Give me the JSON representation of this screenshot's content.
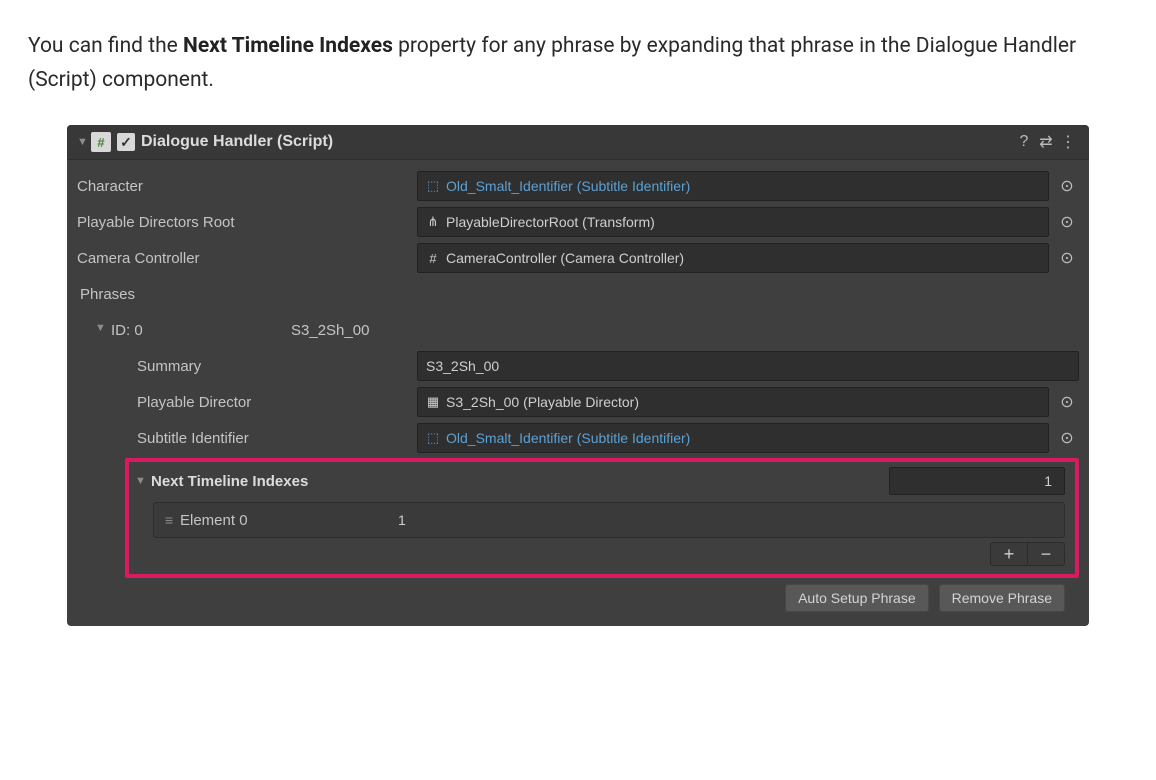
{
  "intro": {
    "t1": "You can find the ",
    "b1": "Next Timeline Indexes",
    "t2": " property for any phrase by expanding that phrase in the Dialogue Handler (Script) component."
  },
  "header": {
    "script_glyph": "#",
    "check": "✓",
    "title": "Dialogue Handler (Script)",
    "help": "?",
    "preset": "⇄",
    "menu": "⋮"
  },
  "fields": {
    "character_label": "Character",
    "character_value": "Old_Smalt_Identifier (Subtitle Identifier)",
    "pdr_label": "Playable Directors Root",
    "pdr_value": "PlayableDirectorRoot (Transform)",
    "cam_label": "Camera Controller",
    "cam_value": "CameraController (Camera Controller)",
    "phrases_label": "Phrases"
  },
  "phrase": {
    "id_label": "ID: 0",
    "id_tag": "S3_2Sh_00",
    "summary_label": "Summary",
    "summary_value": "S3_2Sh_00",
    "pd_label": "Playable Director",
    "pd_value": "S3_2Sh_00 (Playable Director)",
    "si_label": "Subtitle Identifier",
    "si_value": "Old_Smalt_Identifier (Subtitle Identifier)"
  },
  "nti": {
    "title": "Next Timeline Indexes",
    "count": "1",
    "elem_label": "Element 0",
    "elem_value": "1",
    "plus": "+",
    "minus": "−"
  },
  "buttons": {
    "auto": "Auto Setup Phrase",
    "remove": "Remove Phrase"
  },
  "icons": {
    "cube": "⬚",
    "transform": "⋔",
    "hash": "#",
    "director": "▦",
    "picker": "⊙",
    "fold_down": "▼",
    "drag": "≡"
  }
}
